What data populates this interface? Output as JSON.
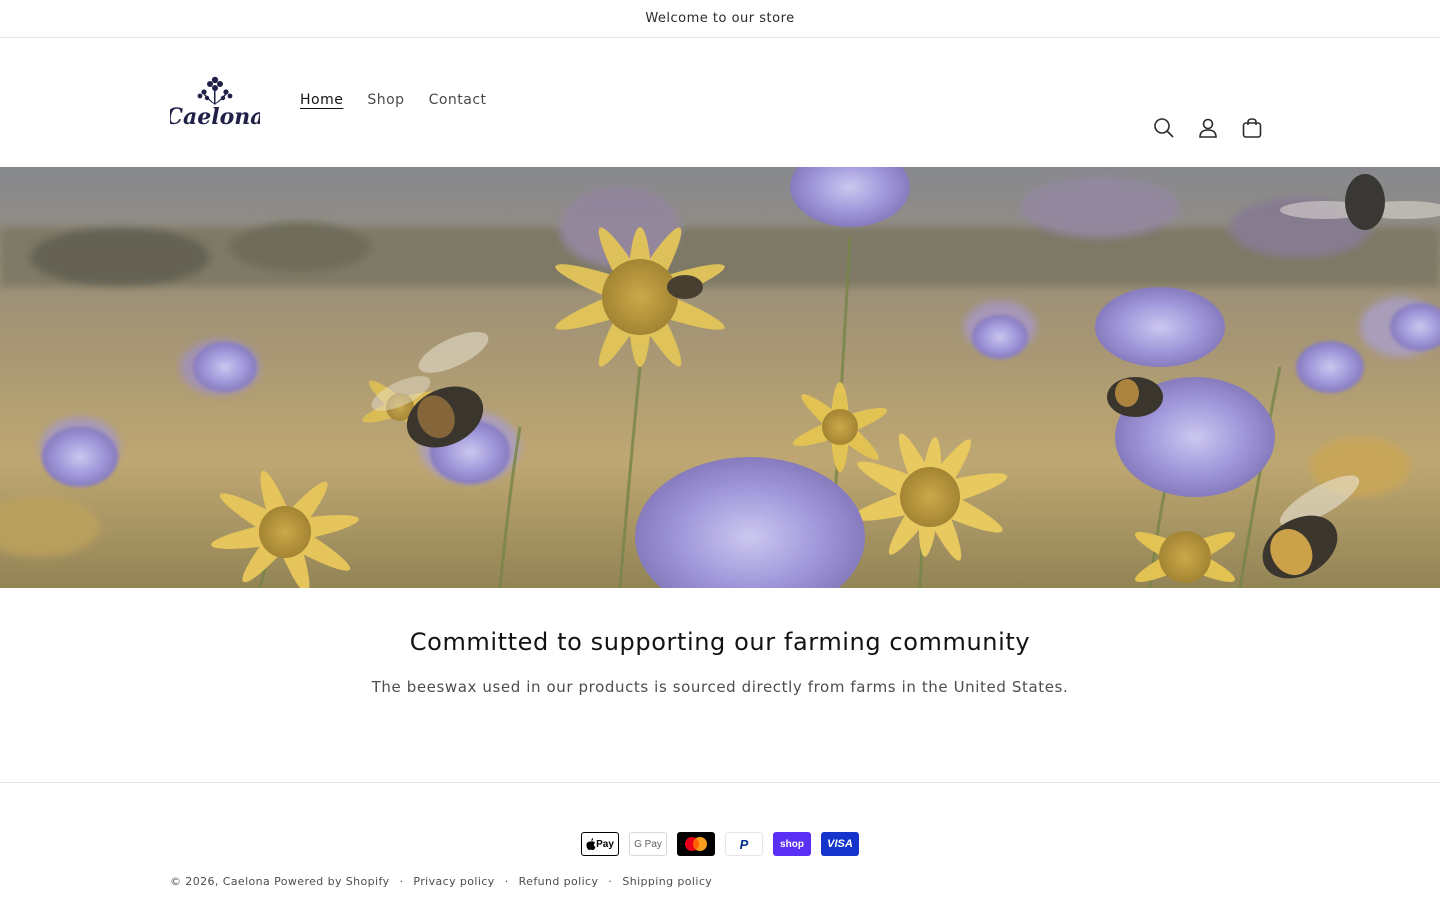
{
  "announcement": {
    "text": "Welcome to our store"
  },
  "header": {
    "logo": {
      "text": "Caelona",
      "icon": "flower-logo-icon"
    },
    "nav": [
      {
        "label": "Home",
        "active": true
      },
      {
        "label": "Shop",
        "active": false
      },
      {
        "label": "Contact",
        "active": false
      }
    ],
    "icons": [
      "search-icon",
      "account-icon",
      "cart-icon"
    ]
  },
  "hero": {
    "image": "wildflower-field-with-bees"
  },
  "section": {
    "heading": "Committed to supporting our farming community",
    "body": "The beeswax used in our products is sourced directly from farms in the United States."
  },
  "footer": {
    "payments": [
      {
        "name": "Apple Pay",
        "label": "Pay",
        "icon": "apple-pay-icon"
      },
      {
        "name": "Google Pay",
        "label": "G Pay",
        "icon": "google-pay-icon"
      },
      {
        "name": "Mastercard",
        "label": "",
        "icon": "mastercard-icon"
      },
      {
        "name": "PayPal",
        "label": "P",
        "icon": "paypal-icon"
      },
      {
        "name": "Shop Pay",
        "label": "shop",
        "icon": "shop-pay-icon"
      },
      {
        "name": "Visa",
        "label": "VISA",
        "icon": "visa-icon"
      }
    ],
    "copyright_prefix": "© 2026,",
    "store_name": "Caelona",
    "powered_by": "Powered by Shopify",
    "separator": "·",
    "policies": [
      "Privacy policy",
      "Refund policy",
      "Shipping policy"
    ]
  },
  "colors": {
    "text": "#121212",
    "muted": "#4d4d4d",
    "border": "#e6e6e6",
    "shop_pay": "#5a31f4",
    "visa": "#1434cb",
    "logo": "#1f2147"
  }
}
